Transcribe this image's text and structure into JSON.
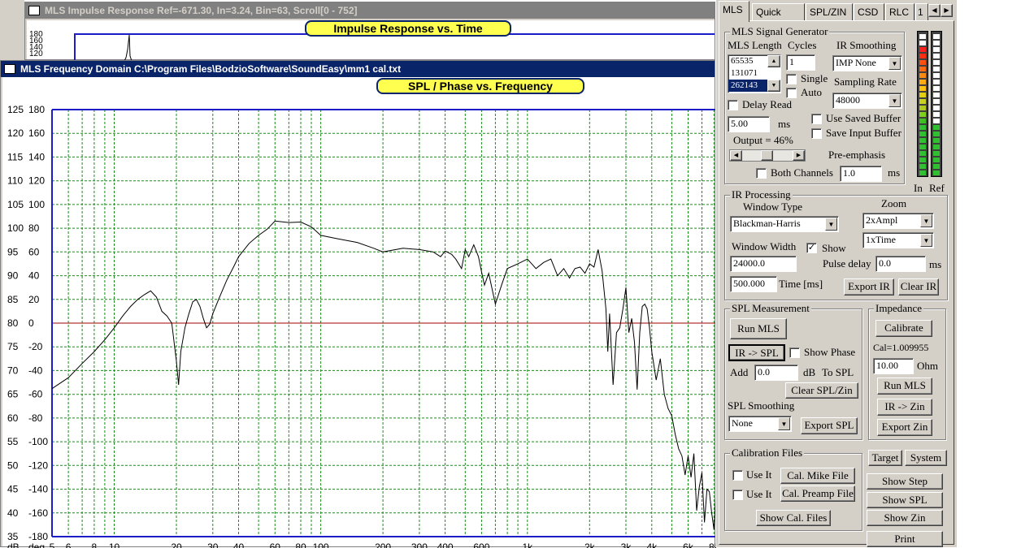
{
  "impulse_window": {
    "title": "MLS Impulse Response  Ref=-671.30, In=3.24, Bin=63, Scroll[0 - 752]",
    "plot_title": "Impulse Response vs. Time",
    "y_labels": [
      "180",
      "160",
      "140",
      "120"
    ]
  },
  "freq_window": {
    "title": "MLS Frequency Domain  C:\\Program Files\\BodzioSoftware\\SoundEasy\\mm1 cal.txt",
    "plot_title": "SPL / Phase vs. Frequency",
    "db_unit": "dB",
    "deg_unit": "deg"
  },
  "chart_data": {
    "type": "line",
    "title": "SPL / Phase vs. Frequency",
    "x_scale": "log",
    "xlim": [
      5,
      8200
    ],
    "x_ticks": [
      "5",
      "6",
      "8",
      "10",
      "20",
      "30",
      "40",
      "60",
      "80",
      "100",
      "200",
      "300",
      "400",
      "600",
      "1k",
      "2k",
      "3k",
      "4k",
      "6k",
      "8k"
    ],
    "y_left_ticks": [
      "125",
      "120",
      "115",
      "110",
      "105",
      "100",
      "95",
      "90",
      "85",
      "80",
      "75",
      "70",
      "65",
      "60",
      "55",
      "50",
      "45",
      "40",
      "35"
    ],
    "y_right_ticks": [
      "180",
      "160",
      "140",
      "120",
      "100",
      "80",
      "60",
      "40",
      "20",
      "0",
      "-20",
      "-40",
      "-60",
      "-80",
      "-100",
      "-120",
      "-140",
      "-160",
      "-180"
    ],
    "ylim_db": [
      35,
      125
    ],
    "ylim_deg": [
      -180,
      180
    ],
    "zero_line_deg": 0,
    "colors": {
      "curve": "#000000",
      "grid": "#1a8c1a",
      "zero_line": "#a00000",
      "frame": "#1c1cc8"
    },
    "series": [
      {
        "x": [
          5,
          6,
          7,
          8,
          9,
          10,
          11,
          12,
          13,
          14,
          15,
          16,
          17,
          18,
          19,
          20,
          20.5,
          21,
          22,
          23,
          24,
          25,
          26,
          27,
          28,
          29,
          30,
          32,
          35,
          38,
          40,
          45,
          50,
          55,
          60,
          70,
          80,
          90,
          100,
          120,
          150,
          180,
          200,
          250,
          300,
          350,
          380,
          400,
          430,
          450,
          480,
          500,
          520,
          550,
          580,
          600,
          620,
          650,
          700,
          750,
          800,
          900,
          1000,
          1100,
          1200,
          1300,
          1400,
          1500,
          1600,
          1700,
          1800,
          1900,
          2000,
          2100,
          2200,
          2300,
          2400,
          2450,
          2500,
          2600,
          2700,
          2800,
          2900,
          3000,
          3100,
          3200,
          3300,
          3400,
          3500,
          3600,
          3700,
          3800,
          3900,
          4000,
          4200,
          4400,
          4600,
          4800,
          5000,
          5200,
          5400,
          5600,
          5800,
          6000,
          6200,
          6400,
          6600,
          6800,
          7000,
          7200,
          7400,
          7600,
          7800,
          8000,
          8200
        ],
        "y": [
          66.2,
          68.5,
          71.5,
          74,
          76.5,
          79,
          81.5,
          83.5,
          85,
          86,
          86.8,
          85.5,
          82.5,
          81.5,
          80,
          72,
          67,
          74,
          79,
          82,
          84.5,
          85,
          83.5,
          81,
          79,
          79.8,
          82,
          85,
          89,
          92,
          94,
          96.8,
          98.5,
          99.8,
          101.5,
          101.2,
          101.3,
          100.3,
          98.5,
          97.8,
          97,
          95.8,
          95,
          95.8,
          95.5,
          95,
          94,
          95.2,
          94.5,
          93.5,
          91.5,
          95.5,
          94,
          96.5,
          94,
          90.8,
          88,
          90.5,
          84,
          88,
          91.5,
          92.5,
          93.5,
          91.5,
          92.8,
          93.5,
          90,
          91.5,
          89.5,
          91.5,
          91.8,
          90.5,
          92.5,
          91.8,
          95.5,
          91,
          83,
          74,
          82,
          67,
          78,
          79,
          83,
          87.5,
          78,
          81,
          76,
          66,
          78,
          83.5,
          84,
          83,
          79,
          74,
          68,
          72.5,
          65,
          62,
          60.5,
          56.5,
          53.5,
          52,
          48,
          52,
          47.5,
          52.5,
          40.5,
          45.5,
          48.5,
          38,
          45,
          44.5,
          40,
          36.5,
          45
        ]
      }
    ]
  },
  "panel": {
    "tabs": [
      "MLS",
      "Quick SPL",
      "SPL/ZIN",
      "CSD",
      "RLC",
      "1"
    ],
    "tab_prev": "◀",
    "tab_next": "▶",
    "signal_gen": {
      "label": "MLS Signal Generator",
      "mls_length_label": "MLS Length",
      "mls_lengths": [
        "65535",
        "131071",
        "262143"
      ],
      "cycles_label": "Cycles",
      "cycles_value": "1",
      "ir_smoothing_label": "IR Smoothing",
      "ir_smoothing_value": "IMP None",
      "single_label": "Single",
      "auto_label": "Auto",
      "sampling_rate_label": "Sampling Rate",
      "sampling_rate_value": "48000",
      "delay_read_label": "Delay Read",
      "delay_value": "5.00",
      "delay_unit": "ms",
      "use_saved_buffer_label": "Use Saved Buffer",
      "save_input_buffer_label": "Save Input Buffer",
      "output_label": "Output = 46%",
      "output_level": 46,
      "pre_emphasis_label": "Pre-emphasis",
      "both_channels_label": "Both Channels",
      "pre_emphasis_value": "1.0",
      "pre_emphasis_unit": "ms"
    },
    "meters": {
      "in_label": "In",
      "ref_label": "Ref"
    },
    "ir_processing": {
      "label": "IR Processing",
      "window_type_label": "Window Type",
      "window_type_value": "Blackman-Harris",
      "zoom_label": "Zoom",
      "zoom_ampl_value": "2xAmpl",
      "zoom_time_value": "1xTime",
      "window_width_label": "Window Width",
      "window_width_value": "24000.0",
      "show_label": "Show",
      "pulse_delay_label": "Pulse delay",
      "pulse_delay_value": "0.0",
      "pulse_delay_unit": "ms",
      "time_value": "500.000",
      "time_label": "Time [ms]",
      "export_ir": "Export IR",
      "clear_ir": "Clear IR"
    },
    "spl_measurement": {
      "label": "SPL Measurement",
      "run_mls": "Run MLS",
      "ir_to_spl": "IR -> SPL",
      "show_phase_label": "Show Phase",
      "add_label": "Add",
      "add_value": "0.0",
      "add_unit": "dB",
      "to_spl_label": "To SPL",
      "clear_spl_zin": "Clear SPL/Zin",
      "spl_smoothing_label": "SPL Smoothing",
      "spl_smoothing_value": "None",
      "export_spl": "Export SPL"
    },
    "impedance": {
      "label": "Impedance",
      "calibrate": "Calibrate",
      "cal_value": "Cal=1.009955",
      "ohm_value": "10.00",
      "ohm_unit": "Ohm",
      "run_mls": "Run MLS",
      "ir_to_zin": "IR -> Zin",
      "export_zin": "Export Zin"
    },
    "calibration_files": {
      "label": "Calibration Files",
      "use_it_1": "Use It",
      "cal_mike": "Cal. Mike File",
      "use_it_2": "Use It",
      "cal_preamp": "Cal. Preamp File",
      "show_cal_files": "Show Cal. Files"
    },
    "side_buttons": {
      "target": "Target",
      "system": "System",
      "show_step": "Show Step",
      "show_spl": "Show SPL",
      "show_zin": "Show Zin",
      "print": "Print"
    }
  }
}
